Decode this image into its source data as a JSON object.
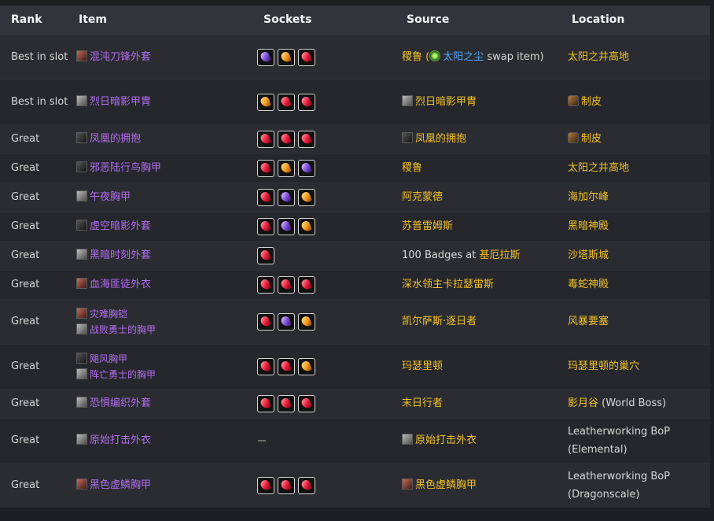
{
  "headers": {
    "rank": "Rank",
    "item": "Item",
    "sockets": "Sockets",
    "source": "Source",
    "location": "Location"
  },
  "colors": {
    "epic": "#b36cf0",
    "gold": "#f3c126",
    "link_blue": "#4fa7ff"
  },
  "rows": [
    {
      "rank": "Best in slot",
      "item": "混沌刀锋外套",
      "item_icon": "chest-armor-icon",
      "sockets": [
        "purple",
        "yellow",
        "red"
      ],
      "source_prefix": "稷鲁 (",
      "source_link": "太阳之尘",
      "source_suffix": " swap item)",
      "location": "太阳之井高地"
    },
    {
      "rank": "Best in slot",
      "item": "烈日暗影甲胄",
      "item_icon": "chest-armor-icon",
      "sockets": [
        "yellow",
        "red",
        "red"
      ],
      "source": "烈日暗影甲胄",
      "location": "制皮"
    },
    {
      "rank": "Great",
      "item": "凤凰的拥抱",
      "item_icon": "chest-armor-icon",
      "sockets": [
        "red",
        "red",
        "red"
      ],
      "source": "凤凰的拥抱",
      "location": "制皮"
    },
    {
      "rank": "Great",
      "item": "邪恶陆行鸟胸甲",
      "item_icon": "chest-armor-icon",
      "sockets": [
        "red",
        "yellow",
        "purple"
      ],
      "source": "稷鲁",
      "location": "太阳之井高地"
    },
    {
      "rank": "Great",
      "item": "午夜胸甲",
      "item_icon": "chest-armor-icon",
      "sockets": [
        "red",
        "purple",
        "yellow"
      ],
      "source": "阿克蒙德",
      "location": "海加尔峰"
    },
    {
      "rank": "Great",
      "item": "虚空暗影外套",
      "item_icon": "chest-armor-icon",
      "sockets": [
        "red",
        "purple",
        "yellow"
      ],
      "source": "苏普雷姆斯",
      "location": "黑暗神殿"
    },
    {
      "rank": "Great",
      "item": "黑暗时刻外套",
      "item_icon": "chest-armor-icon",
      "sockets": [
        "red"
      ],
      "source_plain": "100 Badges at ",
      "source_gold": "基厄拉斯",
      "location": "沙塔斯城"
    },
    {
      "rank": "Great",
      "item": "血海匪徒外衣",
      "item_icon": "chest-armor-icon",
      "sockets": [
        "red",
        "red",
        "red"
      ],
      "source": "深水领主卡拉瑟雷斯",
      "location": "毒蛇神殿"
    },
    {
      "rank": "Great",
      "item": "灾难胸铠",
      "item2": "战败勇士的胸甲",
      "item_icon": "chest-armor-icon",
      "sockets": [
        "red",
        "purple",
        "yellow"
      ],
      "source": "凯尔萨斯·逐日者",
      "location": "风暴要塞"
    },
    {
      "rank": "Great",
      "item": "飓风胸甲",
      "item2": "阵亡勇士的胸甲",
      "item_icon": "chest-armor-icon",
      "sockets": [
        "red",
        "red",
        "yellow"
      ],
      "source": "玛瑟里顿",
      "location": "玛瑟里顿的巢穴"
    },
    {
      "rank": "Great",
      "item": "恐惧编织外套",
      "item_icon": "chest-armor-icon",
      "sockets": [
        "red",
        "red",
        "red"
      ],
      "source": "末日行者",
      "location_gold": "影月谷",
      "location_plain": " (World Boss)"
    },
    {
      "rank": "Great",
      "item": "原始打击外衣",
      "item_icon": "chest-armor-icon",
      "sockets": [],
      "source": "原始打击外衣",
      "location": "Leatherworking BoP (Elemental)"
    },
    {
      "rank": "Great",
      "item": "黑色虚鳞胸甲",
      "item_icon": "chest-armor-icon",
      "sockets": [
        "red",
        "red",
        "red"
      ],
      "source": "黑色虚鳞胸甲",
      "location": "Leatherworking BoP (Dragonscale)"
    }
  ]
}
